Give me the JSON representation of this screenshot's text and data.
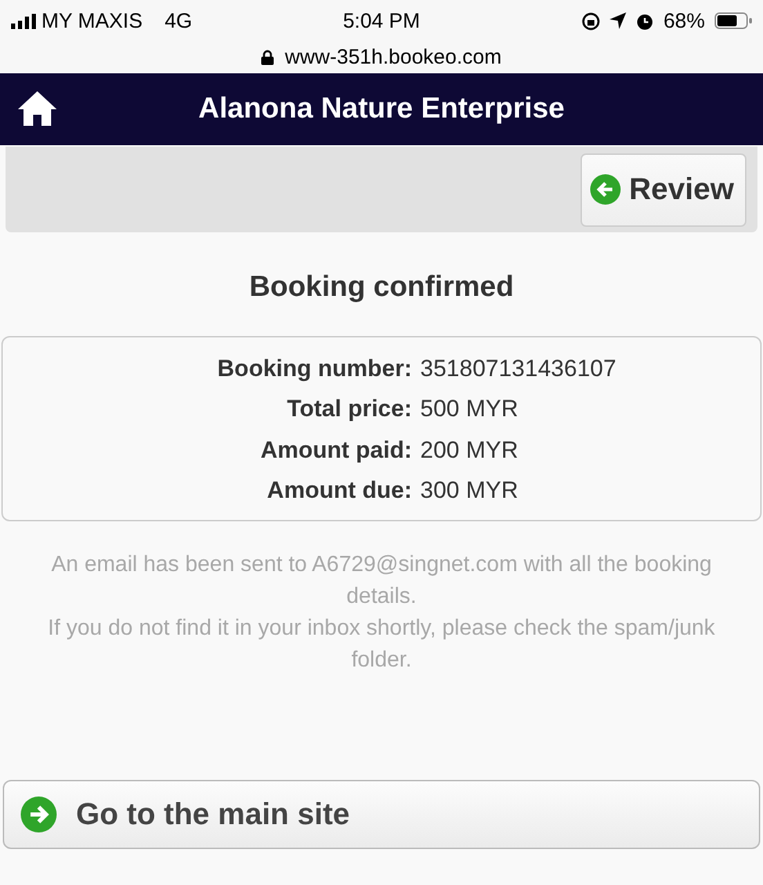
{
  "status_bar": {
    "carrier": "MY MAXIS",
    "network": "4G",
    "time": "5:04 PM",
    "battery": "68%"
  },
  "address_bar": {
    "url": "www-351h.bookeo.com"
  },
  "header": {
    "title": "Alanona Nature Enterprise"
  },
  "toolbar": {
    "review_button": "Review"
  },
  "page_title": "Booking confirmed",
  "details": [
    {
      "label": "Booking number:",
      "value": "351807131436107"
    },
    {
      "label": "Total price:",
      "value": "500 MYR"
    },
    {
      "label": "Amount paid:",
      "value": "200 MYR"
    },
    {
      "label": "Amount due:",
      "value": "300 MYR"
    }
  ],
  "message": [
    "An email has been sent to A6729@singnet.com with all the booking details.",
    "If you do not find it in your inbox shortly, please check the spam/junk folder."
  ],
  "main_site_button": "Go to the main site"
}
